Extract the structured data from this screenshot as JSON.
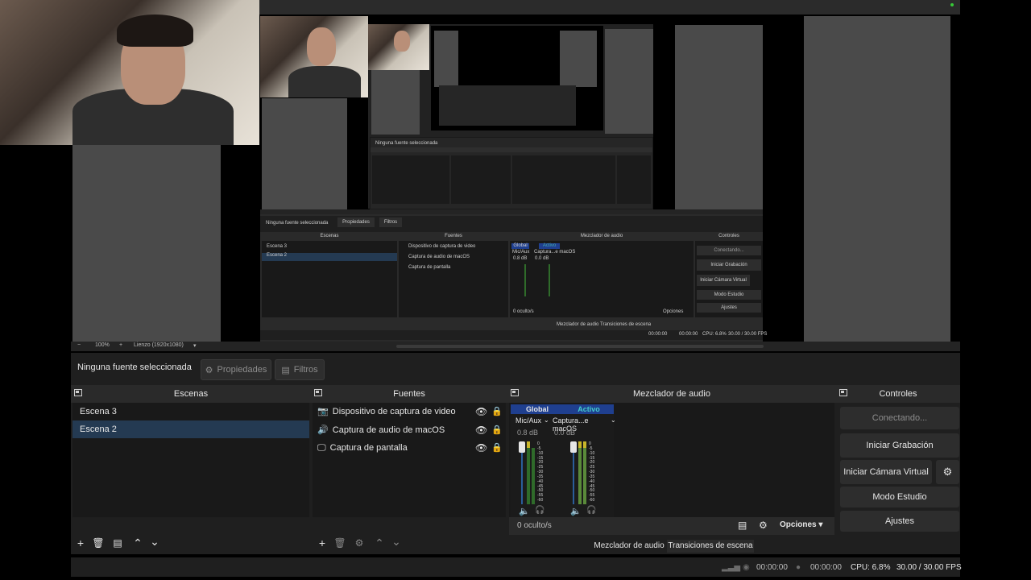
{
  "preview": {
    "nested_no_source": "Ninguna fuente seleccionada",
    "nested_props": "Propiedades",
    "nested_filters": "Filtros",
    "nested_docks": [
      "Escenas",
      "Fuentes",
      "Mezclador de audio",
      "Controles"
    ],
    "nested_scenes": [
      "Escena 3",
      "Escena 2"
    ],
    "nested_sources": [
      "Dispositivo de captura de video",
      "Captura de audio de macOS",
      "Captura de pantalla"
    ],
    "nested_controls": [
      "Conectando...",
      "Iniciar Grabación",
      "Iniciar Cámara Virtual",
      "Modo Estudio",
      "Ajustes"
    ],
    "nested_mixer_global": "Global",
    "nested_mixer_active": "Activo",
    "nested_mixer_ch1": "Mic/Aux",
    "nested_mixer_ch2": "Captura...e macOS",
    "nested_mixer_db1": "0.8 dB",
    "nested_mixer_db2": "0.0 dB",
    "nested_hidden": "0 oculto/s",
    "nested_options": "Opciones",
    "nested_tab1": "Mezclador de audio",
    "nested_tab2": "Transiciones de escena",
    "nested_status": [
      "00:00:00",
      "00:00:00",
      "CPU: 6.8%",
      "30.00 / 30.00 FPS"
    ]
  },
  "zoom_bar": {
    "minus": "−",
    "zoom": "100%",
    "plus": "+",
    "canvas": "Lienzo (1920x1080)",
    "dropdown": "▾"
  },
  "props_bar": {
    "no_source": "Ninguna fuente seleccionada",
    "properties": "Propiedades",
    "filters": "Filtros"
  },
  "scenes": {
    "title": "Escenas",
    "items": [
      "Escena 3",
      "Escena 2"
    ],
    "selected_index": 1
  },
  "sources": {
    "title": "Fuentes",
    "items": [
      {
        "label": "Dispositivo de captura de video",
        "icon": "camera-icon"
      },
      {
        "label": "Captura de audio de macOS",
        "icon": "speaker-icon"
      },
      {
        "label": "Captura de pantalla",
        "icon": "monitor-icon"
      }
    ]
  },
  "mixer": {
    "title": "Mezclador de audio",
    "global_label": "Global",
    "active_label": "Activo",
    "channels": [
      {
        "name": "Mic/Aux",
        "db": "0.8 dB"
      },
      {
        "name": "Captura...e macOS",
        "db": "0.0 dB"
      }
    ],
    "ticks": [
      "0",
      "-5",
      "-10",
      "-15",
      "-20",
      "-25",
      "-30",
      "-35",
      "-40",
      "-45",
      "-50",
      "-55",
      "-60"
    ],
    "hidden_label": "0 oculto/s",
    "options_label": "Opciones",
    "tabs": [
      "Mezclador de audio",
      "Transiciones de escena"
    ]
  },
  "controls": {
    "title": "Controles",
    "connecting": "Conectando...",
    "start_recording": "Iniciar Grabación",
    "start_virtual_cam": "Iniciar Cámara Virtual",
    "studio_mode": "Modo Estudio",
    "settings": "Ajustes"
  },
  "status": {
    "time1": "00:00:00",
    "time2": "00:00:00",
    "cpu": "CPU: 6.8%",
    "fps": "30.00 / 30.00 FPS"
  },
  "colors": {
    "selected_row": "#243a52",
    "meter_green": "#2f6b2a",
    "meter_yellow": "#c9b62a",
    "global_tab": "#1f3f8f"
  }
}
